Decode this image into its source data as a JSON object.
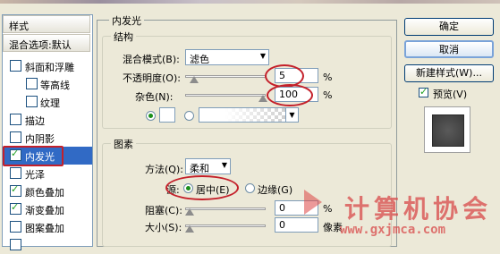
{
  "left_panel": {
    "header": "样式",
    "blend_default": "混合选项:默认",
    "items": [
      {
        "label": "斜面和浮雕",
        "checked": false
      },
      {
        "label": "等高线",
        "checked": false
      },
      {
        "label": "纹理",
        "checked": false
      },
      {
        "label": "描边",
        "checked": false
      },
      {
        "label": "内阴影",
        "checked": false
      },
      {
        "label": "内发光",
        "checked": true
      },
      {
        "label": "光泽",
        "checked": false
      },
      {
        "label": "颜色叠加",
        "checked": true
      },
      {
        "label": "渐变叠加",
        "checked": true
      },
      {
        "label": "图案叠加",
        "checked": false
      }
    ]
  },
  "panel_title": "内发光",
  "structure": {
    "title": "结构",
    "blend_mode_label": "混合模式(B):",
    "blend_mode_value": "滤色",
    "opacity_label": "不透明度(O):",
    "opacity_value": "5",
    "opacity_unit": "%",
    "noise_label": "杂色(N):",
    "noise_value": "100",
    "noise_unit": "%"
  },
  "elements": {
    "title": "图素",
    "method_label": "方法(Q):",
    "method_value": "柔和",
    "source_label": "源:",
    "source_center": "居中(E)",
    "source_edge": "边缘(G)",
    "choke_label": "阻塞(C):",
    "choke_value": "0",
    "choke_unit": "%",
    "size_label": "大小(S):",
    "size_value": "0",
    "size_unit": "像素"
  },
  "buttons": {
    "ok": "确定",
    "cancel": "取消",
    "new_style": "新建样式(W)...",
    "preview": "预览(V)"
  },
  "watermark": {
    "text": "计算机协会",
    "url": "www.gxjmca.com"
  }
}
